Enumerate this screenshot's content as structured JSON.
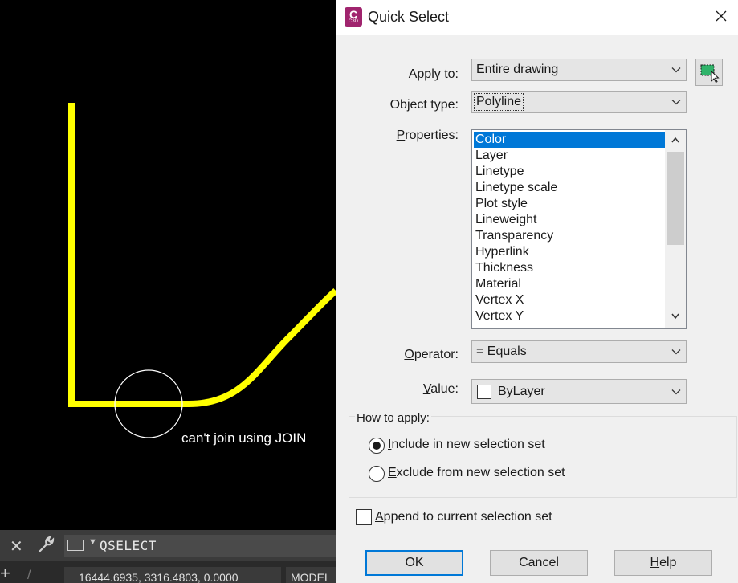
{
  "canvas": {
    "annotation": "can't join using JOIN",
    "polyline_color": "#ffff00",
    "background": "#000000"
  },
  "command_line": {
    "command": "QSELECT"
  },
  "status_bar": {
    "coordinates": "16444.6935, 3316.4803, 0.0000",
    "model_tab": "MODEL"
  },
  "dialog": {
    "title": "Quick Select",
    "app_icon_letter": "C",
    "app_icon_sub": "C3D",
    "apply_to": {
      "label": "Apply to:",
      "value": "Entire drawing"
    },
    "object_type": {
      "label": "Object type:",
      "value": "Polyline"
    },
    "properties": {
      "label": "Properties:",
      "selected_index": 0,
      "items": [
        "Color",
        "Layer",
        "Linetype",
        "Linetype scale",
        "Plot style",
        "Lineweight",
        "Transparency",
        "Hyperlink",
        "Thickness",
        "Material",
        "Vertex X",
        "Vertex Y"
      ]
    },
    "operator": {
      "label": "Operator:",
      "value": "= Equals"
    },
    "value": {
      "label": "Value:",
      "value": "ByLayer"
    },
    "how_to_apply": {
      "label": "How to apply:",
      "include": {
        "label": "Include in new selection set",
        "selected": true
      },
      "exclude": {
        "label": "Exclude from new selection set",
        "selected": false
      }
    },
    "append": {
      "label": "Append to current selection set",
      "checked": false
    },
    "buttons": {
      "ok": "OK",
      "cancel": "Cancel",
      "help": "Help"
    },
    "accent_color": "#0078d7"
  }
}
